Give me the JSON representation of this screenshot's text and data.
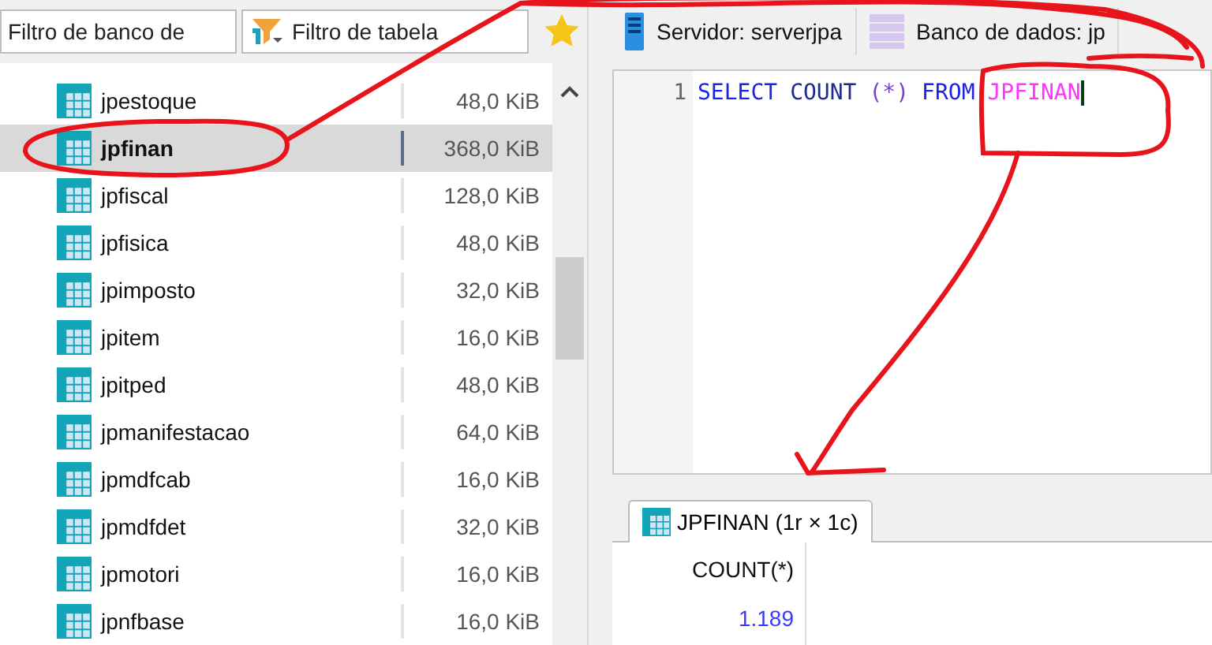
{
  "database_filter": {
    "placeholder": "Filtro de banco de"
  },
  "table_filter": {
    "placeholder": "Filtro de tabela"
  },
  "tables": [
    {
      "name": "jpestoque",
      "size": "48,0 KiB",
      "selected": false
    },
    {
      "name": "jpfinan",
      "size": "368,0 KiB",
      "selected": true
    },
    {
      "name": "jpfiscal",
      "size": "128,0 KiB",
      "selected": false
    },
    {
      "name": "jpfisica",
      "size": "48,0 KiB",
      "selected": false
    },
    {
      "name": "jpimposto",
      "size": "32,0 KiB",
      "selected": false
    },
    {
      "name": "jpitem",
      "size": "16,0 KiB",
      "selected": false
    },
    {
      "name": "jpitped",
      "size": "48,0 KiB",
      "selected": false
    },
    {
      "name": "jpmanifestacao",
      "size": "64,0 KiB",
      "selected": false
    },
    {
      "name": "jpmdfcab",
      "size": "16,0 KiB",
      "selected": false
    },
    {
      "name": "jpmdfdet",
      "size": "32,0 KiB",
      "selected": false
    },
    {
      "name": "jpmotori",
      "size": "16,0 KiB",
      "selected": false
    },
    {
      "name": "jpnfbase",
      "size": "16,0 KiB",
      "selected": false
    }
  ],
  "tabs": [
    {
      "kind": "server",
      "label": "Servidor: serverjpa"
    },
    {
      "kind": "database",
      "label": "Banco de dados: jp"
    }
  ],
  "editor": {
    "line_number": "1",
    "tokens": [
      {
        "kind": "keyword",
        "text": "SELECT"
      },
      {
        "kind": "function",
        "text": "COUNT"
      },
      {
        "kind": "symbol",
        "text": "(*)"
      },
      {
        "kind": "keyword",
        "text": "FROM"
      },
      {
        "kind": "table",
        "text": "JPFINAN"
      }
    ]
  },
  "results": {
    "tab": "JPFINAN (1r × 1c)",
    "column": "COUNT(*)",
    "value": "1.189"
  }
}
